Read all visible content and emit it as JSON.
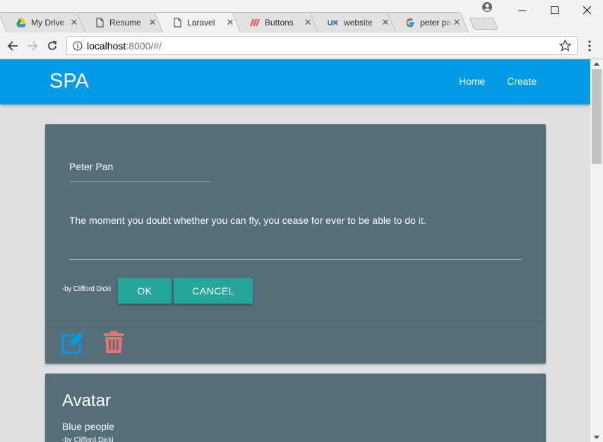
{
  "browser": {
    "tabs": [
      {
        "title": "My Drive",
        "favicon": "google-drive-icon",
        "active": false
      },
      {
        "title": "Resume",
        "favicon": "document-icon",
        "active": false
      },
      {
        "title": "Laravel",
        "favicon": "document-icon",
        "active": true
      },
      {
        "title": "Buttons",
        "favicon": "brand-icon",
        "active": false
      },
      {
        "title": "website",
        "favicon": "ux-icon",
        "active": false
      },
      {
        "title": "peter pan",
        "favicon": "google-icon",
        "active": false
      }
    ],
    "close_glyph": "✕",
    "url_host": "localhost",
    "url_rest": ":8000/#/",
    "colors": {
      "chrome": "#f2f2f2",
      "inactive_tab": "#e2e2e2"
    }
  },
  "app": {
    "brand": "SPA",
    "nav": {
      "home": "Home",
      "create": "Create"
    },
    "colors": {
      "appbar": "#039be5",
      "card": "#546e7a",
      "button": "#26a69a",
      "edit": "#039be5",
      "delete": "#e57373"
    }
  },
  "cards": [
    {
      "name": "Peter Pan",
      "quote": "The moment you doubt whether you can fly, you cease for ever to be able to do it.",
      "byline": "-by Clifford Dicki",
      "ok_label": "OK",
      "cancel_label": "CANCEL",
      "icons": {
        "edit": "edit-icon",
        "delete": "trash-icon"
      }
    },
    {
      "name": "Avatar",
      "quote": "Blue people",
      "byline": "-by Clifford Dicki"
    }
  ]
}
